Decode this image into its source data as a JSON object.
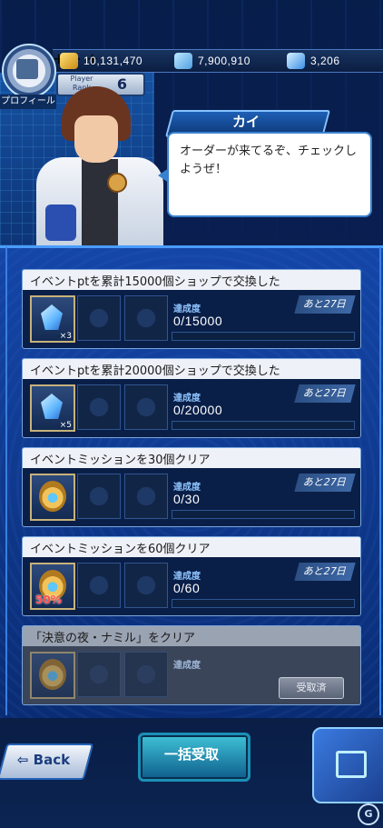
{
  "resources": {
    "gold": "10,131,470",
    "orbs": "7,900,910",
    "gems": "3,206",
    "plus_label": "+"
  },
  "profile": {
    "label": "プロフィール",
    "rank_label": "Player Rank",
    "rank_value": "6"
  },
  "dialog": {
    "speaker": "カイ",
    "text": "オーダーが来てるぞ、チェックしようぜ！"
  },
  "missions": [
    {
      "title": "イベントptを累計15000個ショップで交換した",
      "progress_label": "達成度",
      "progress": "0/15000",
      "days": "あと27日",
      "item": "crystal",
      "qty": "×3"
    },
    {
      "title": "イベントptを累計20000個ショップで交換した",
      "progress_label": "達成度",
      "progress": "0/20000",
      "days": "あと27日",
      "item": "crystal",
      "qty": "×5"
    },
    {
      "title": "イベントミッションを30個クリア",
      "progress_label": "達成度",
      "progress": "0/30",
      "days": "あと27日",
      "item": "egg"
    },
    {
      "title": "イベントミッションを60個クリア",
      "progress_label": "達成度",
      "progress": "0/60",
      "days": "あと27日",
      "item": "egg",
      "badge": "50%"
    },
    {
      "title": "「決意の夜・ナミル」をクリア",
      "progress_label": "達成度",
      "status": "受取済",
      "item": "egg"
    }
  ],
  "buttons": {
    "back": "Back",
    "bulk_receive": "一括受取"
  },
  "watermark": "G"
}
